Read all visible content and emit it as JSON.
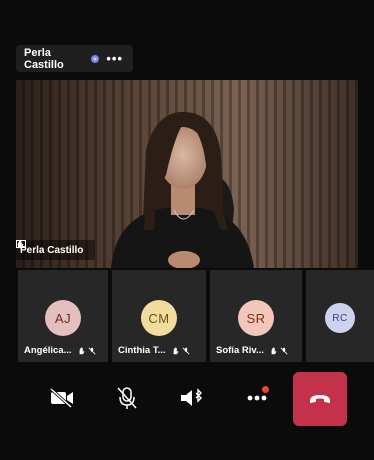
{
  "top_tag": {
    "name": "Perla Castillo",
    "more_label": "•••"
  },
  "main_video": {
    "caption": "Perla Castillo"
  },
  "participants": [
    {
      "initials": "AJ",
      "name": "Angélica...",
      "avatar_bg": "#e3c0bd",
      "avatar_fg": "#6e2a24"
    },
    {
      "initials": "CM",
      "name": "Cinthia T...",
      "avatar_bg": "#f0dc9c",
      "avatar_fg": "#6b5312"
    },
    {
      "initials": "SR",
      "name": "Sofía Riv...",
      "avatar_bg": "#f2c7b9",
      "avatar_fg": "#7e2f1c"
    },
    {
      "initials": "RC",
      "name": "",
      "avatar_bg": "#cfd2ee",
      "avatar_fg": "#3a3f7a"
    }
  ],
  "controls": {
    "camera": "camera-off",
    "mic": "mic-off",
    "speaker": "speaker-bluetooth",
    "more": "more-options",
    "end": "end-call"
  },
  "colors": {
    "end_call": "#c4314b",
    "tile": "#272727",
    "notify": "#e8472b"
  }
}
